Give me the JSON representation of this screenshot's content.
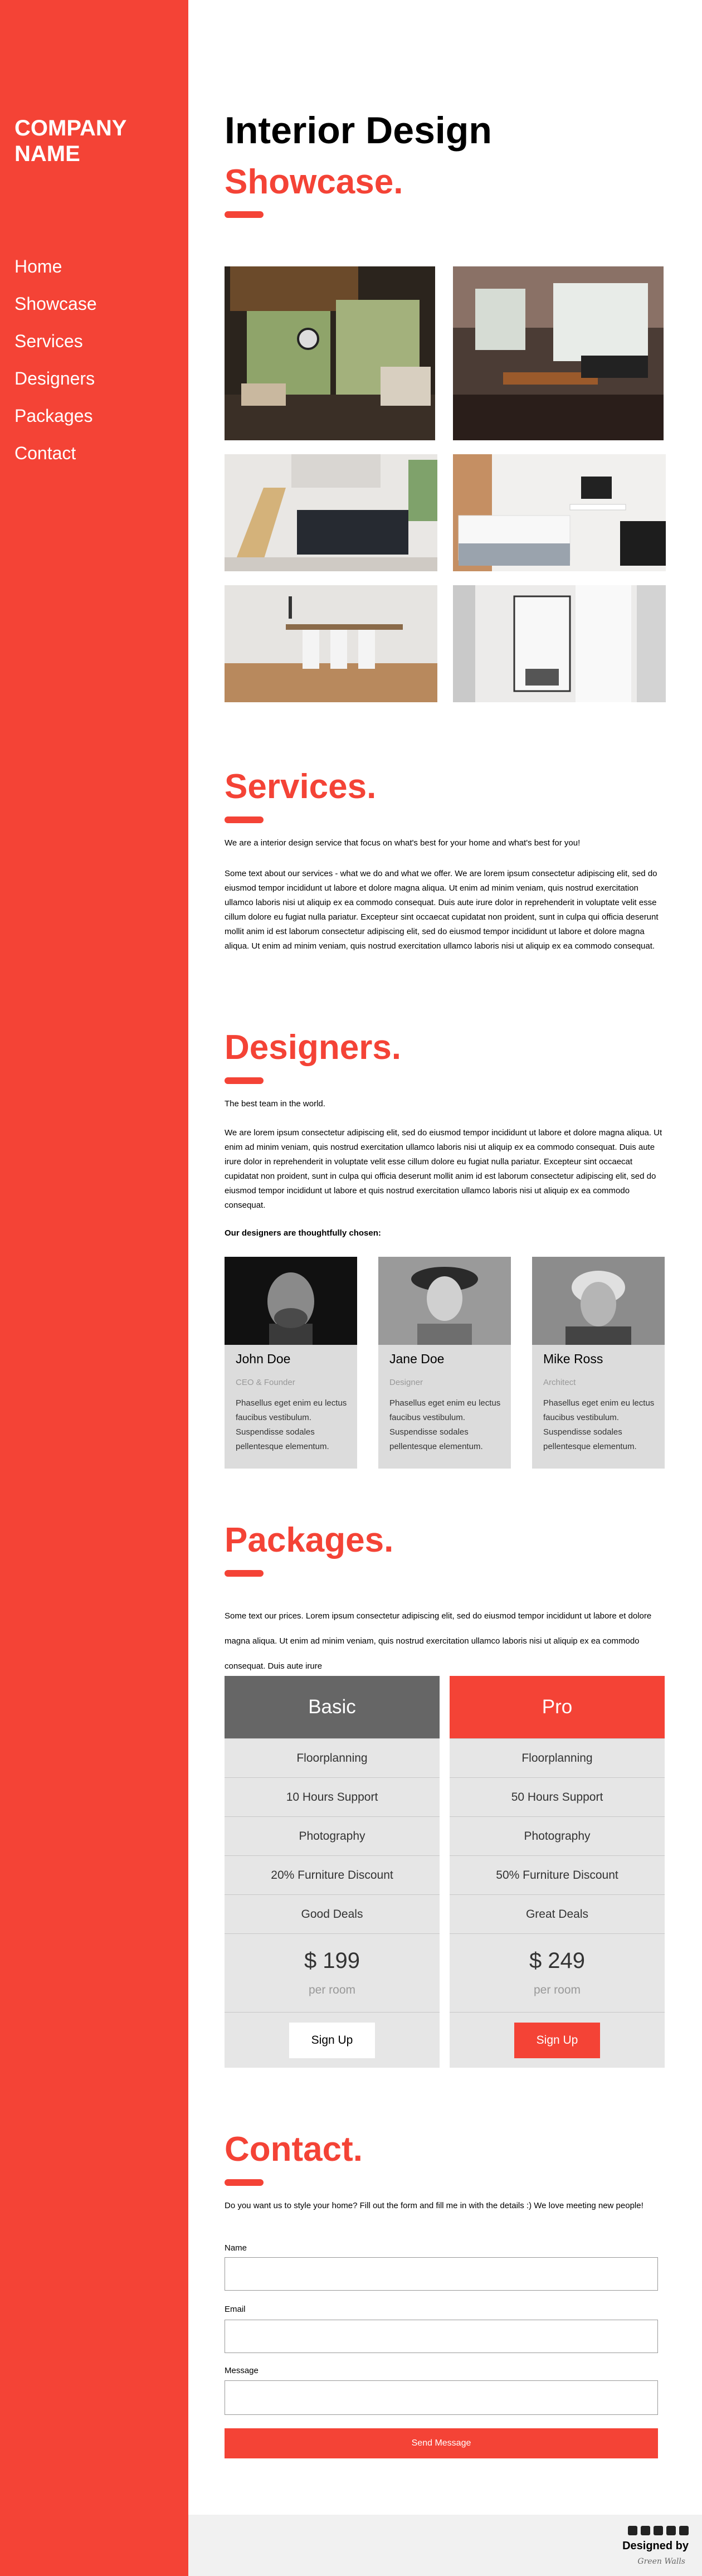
{
  "brand": {
    "name": "COMPANY NAME"
  },
  "nav": [
    {
      "label": "Home"
    },
    {
      "label": "Showcase"
    },
    {
      "label": "Services"
    },
    {
      "label": "Designers"
    },
    {
      "label": "Packages"
    },
    {
      "label": "Contact"
    }
  ],
  "hero": {
    "title": "Interior Design",
    "subtitle": "Showcase."
  },
  "showcase": {
    "photos": [
      "living-room-photo",
      "loft-office-photo",
      "lounge-photo",
      "bedroom-desk-photo",
      "dining-room-photo",
      "hallway-window-photo"
    ]
  },
  "services": {
    "heading": "Services.",
    "intro": "We are a interior design service that focus on what's best for your home and what's best for you!",
    "body": "Some text about our services - what we do and what we offer. We are lorem ipsum consectetur adipiscing elit, sed do eiusmod tempor incididunt ut labore et dolore magna aliqua. Ut enim ad minim veniam, quis nostrud exercitation ullamco laboris nisi ut aliquip ex ea commodo consequat. Duis aute irure dolor in reprehenderit in voluptate velit esse cillum dolore eu fugiat nulla pariatur. Excepteur sint occaecat cupidatat non proident, sunt in culpa qui officia deserunt mollit anim id est laborum consectetur adipiscing elit, sed do eiusmod tempor incididunt ut labore et dolore magna aliqua. Ut enim ad minim veniam, quis nostrud exercitation ullamco laboris nisi ut aliquip ex ea commodo consequat."
  },
  "designers": {
    "heading": "Designers.",
    "intro": "The best team in the world.",
    "body": "We are lorem ipsum consectetur adipiscing elit, sed do eiusmod tempor incididunt ut labore et dolore magna aliqua. Ut enim ad minim veniam, quis nostrud exercitation ullamco laboris nisi ut aliquip ex ea commodo consequat. Duis aute irure dolor in reprehenderit in voluptate velit esse cillum dolore eu fugiat nulla pariatur. Excepteur sint occaecat cupidatat non proident, sunt in culpa qui officia deserunt mollit anim id est laborum consectetur adipiscing elit, sed do eiusmod tempor incididunt ut labore et quis nostrud exercitation ullamco laboris nisi ut aliquip ex ea commodo consequat.",
    "chosen": "Our designers are thoughtfully chosen:",
    "people": [
      {
        "name": "John Doe",
        "role": "CEO & Founder",
        "desc": "Phasellus eget enim eu lectus faucibus vestibulum. Suspendisse sodales pellentesque elementum."
      },
      {
        "name": "Jane Doe",
        "role": "Designer",
        "desc": "Phasellus eget enim eu lectus faucibus vestibulum. Suspendisse sodales pellentesque elementum."
      },
      {
        "name": "Mike Ross",
        "role": "Architect",
        "desc": "Phasellus eget enim eu lectus faucibus vestibulum. Suspendisse sodales pellentesque elementum."
      }
    ]
  },
  "packages": {
    "heading": "Packages.",
    "intro": "Some text our prices. Lorem ipsum consectetur adipiscing elit, sed do eiusmod tempor incididunt ut labore et dolore magna aliqua. Ut enim ad minim veniam, quis nostrud exercitation ullamco laboris nisi ut aliquip ex ea commodo consequat. Duis aute irure",
    "plans": [
      {
        "name": "Basic",
        "color": "#666666",
        "features": [
          "Floorplanning",
          "10 Hours Support",
          "Photography",
          "20% Furniture Discount",
          "Good Deals"
        ],
        "price": "$ 199",
        "per": "per room",
        "cta": "Sign Up"
      },
      {
        "name": "Pro",
        "color": "#f44336",
        "features": [
          "Floorplanning",
          "50 Hours Support",
          "Photography",
          "50% Furniture Discount",
          "Great Deals"
        ],
        "price": "$ 249",
        "per": "per room",
        "cta": "Sign Up"
      }
    ]
  },
  "contact": {
    "heading": "Contact.",
    "intro": "Do you want us to style your home? Fill out the form and fill me in with the details :) We love meeting new people!",
    "name_label": "Name",
    "email_label": "Email",
    "message_label": "Message",
    "submit": "Send Message"
  },
  "footer": {
    "credit": "Designed by",
    "signature": "Green Walls",
    "social_icons": [
      "youtube-icon",
      "facebook-icon",
      "instagram-icon",
      "linkedin-icon",
      "mail-icon"
    ]
  },
  "colors": {
    "accent": "#f44336",
    "basic_header": "#666666",
    "panel": "#e6e6e6",
    "footer_bg": "#f1f1f1"
  }
}
